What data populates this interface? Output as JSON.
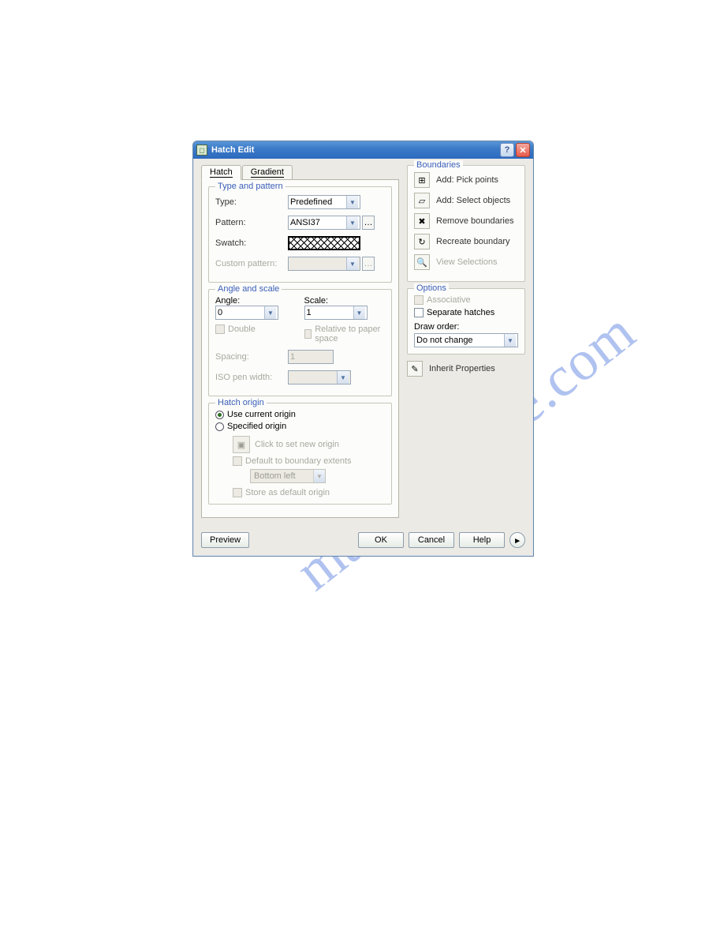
{
  "title": "Hatch Edit",
  "tabs": {
    "hatch": "Hatch",
    "gradient": "Gradient"
  },
  "groups": {
    "type_pattern": {
      "legend": "Type and pattern",
      "type_label": "Type:",
      "type_value": "Predefined",
      "pattern_label": "Pattern:",
      "pattern_value": "ANSI37",
      "swatch_label": "Swatch:",
      "custom_label": "Custom pattern:"
    },
    "angle_scale": {
      "legend": "Angle and scale",
      "angle_label": "Angle:",
      "angle_value": "0",
      "scale_label": "Scale:",
      "scale_value": "1",
      "double": "Double",
      "relative": "Relative to paper space",
      "spacing_label": "Spacing:",
      "spacing_value": "1",
      "iso_label": "ISO pen width:"
    },
    "hatch_origin": {
      "legend": "Hatch origin",
      "use_current": "Use current origin",
      "specified": "Specified origin",
      "click_set": "Click to set new origin",
      "default_extents": "Default to boundary extents",
      "bottom_left": "Bottom left",
      "store_default": "Store as default origin"
    },
    "boundaries": {
      "legend": "Boundaries",
      "pick_points": "Add: Pick points",
      "select_objects": "Add: Select objects",
      "remove": "Remove boundaries",
      "recreate": "Recreate boundary",
      "view_sel": "View Selections"
    },
    "options": {
      "legend": "Options",
      "associative": "Associative",
      "separate": "Separate hatches",
      "draw_order_label": "Draw order:",
      "draw_order_value": "Do not change"
    },
    "inherit": "Inherit Properties"
  },
  "buttons": {
    "preview": "Preview",
    "ok": "OK",
    "cancel": "Cancel",
    "help": "Help"
  }
}
